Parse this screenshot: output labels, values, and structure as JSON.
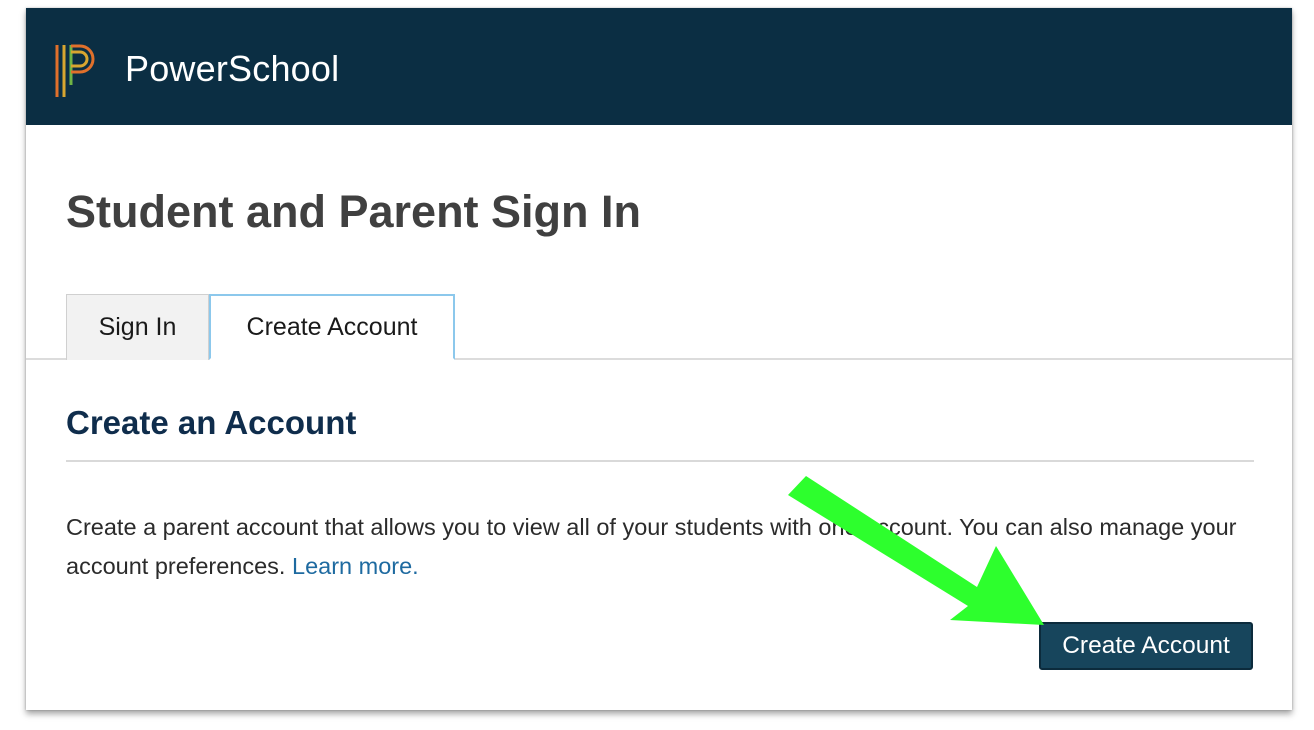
{
  "header": {
    "brand_name": "PowerSchool",
    "background_color": "#0b2e43",
    "logo_icon": "powerschool-p-logo-icon"
  },
  "page": {
    "title": "Student and Parent Sign In"
  },
  "tabs": [
    {
      "label": "Sign In",
      "active": false
    },
    {
      "label": "Create Account",
      "active": true
    }
  ],
  "section": {
    "title": "Create an Account",
    "description": "Create a parent account that allows you to view all of your students with one account. You can also manage your account preferences.",
    "link_text": "Learn more."
  },
  "actions": {
    "create_account_label": "Create Account",
    "button_color": "#17455c"
  },
  "annotation": {
    "arrow_icon": "green-arrow-icon",
    "color": "#2dff2d"
  }
}
